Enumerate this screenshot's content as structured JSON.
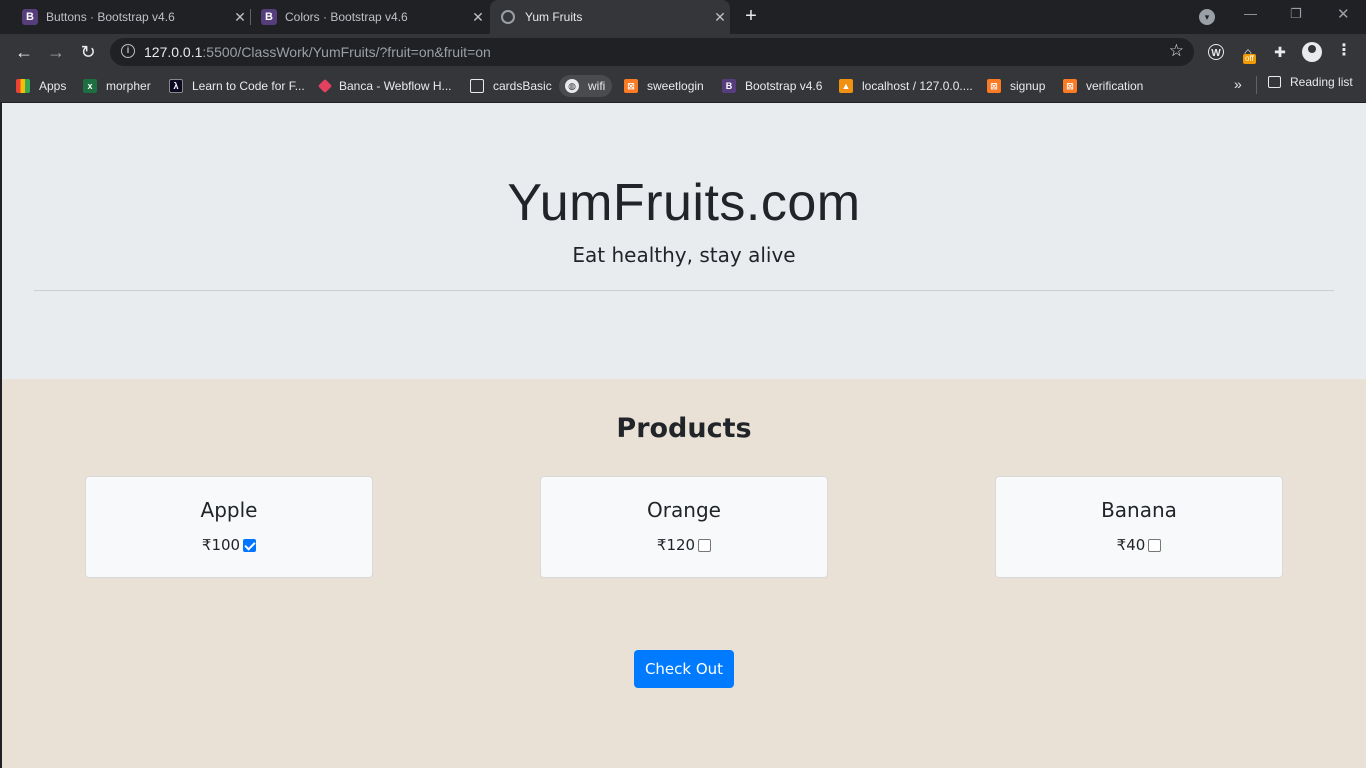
{
  "browser": {
    "tabs": [
      {
        "title": "Buttons · Bootstrap v4.6",
        "favicon": "B",
        "active": false
      },
      {
        "title": "Colors · Bootstrap v4.6",
        "favicon": "B",
        "active": false
      },
      {
        "title": "Yum Fruits",
        "favicon": "globe-icon",
        "active": true
      }
    ],
    "address": {
      "host": "127.0.0.1",
      "rest": ":5500/ClassWork/YumFruits/?fruit=on&fruit=on"
    },
    "extensions": {
      "badge": "off"
    },
    "bookmarks": [
      {
        "label": "Apps",
        "icon": "apps-grid-icon"
      },
      {
        "label": "morpher",
        "icon": "excel-icon"
      },
      {
        "label": "Learn to Code for F...",
        "icon": "freecodecamp-icon"
      },
      {
        "label": "Banca - Webflow H...",
        "icon": "webflow-icon"
      },
      {
        "label": "cardsBasic",
        "icon": "codepen-icon"
      },
      {
        "label": "wifi",
        "icon": "globe-icon"
      },
      {
        "label": "sweetlogin",
        "icon": "xampp-icon"
      },
      {
        "label": "Bootstrap v4.6",
        "icon": "bootstrap-icon"
      },
      {
        "label": "localhost / 127.0.0....",
        "icon": "phpmyadmin-icon"
      },
      {
        "label": "signup",
        "icon": "xampp-icon"
      },
      {
        "label": "verification",
        "icon": "xampp-icon"
      }
    ],
    "reading_list": "Reading list"
  },
  "page": {
    "title": "YumFruits.com",
    "tagline": "Eat healthy, stay alive",
    "products_heading": "Products",
    "products": [
      {
        "name": "Apple",
        "price": "₹100",
        "checked": true
      },
      {
        "name": "Orange",
        "price": "₹120",
        "checked": false
      },
      {
        "name": "Banana",
        "price": "₹40",
        "checked": false
      }
    ],
    "checkout_label": "Check Out"
  },
  "colors": {
    "jumbotron_bg": "#e9ecef",
    "products_bg": "#e9e1d6",
    "button_primary": "#007bff"
  }
}
